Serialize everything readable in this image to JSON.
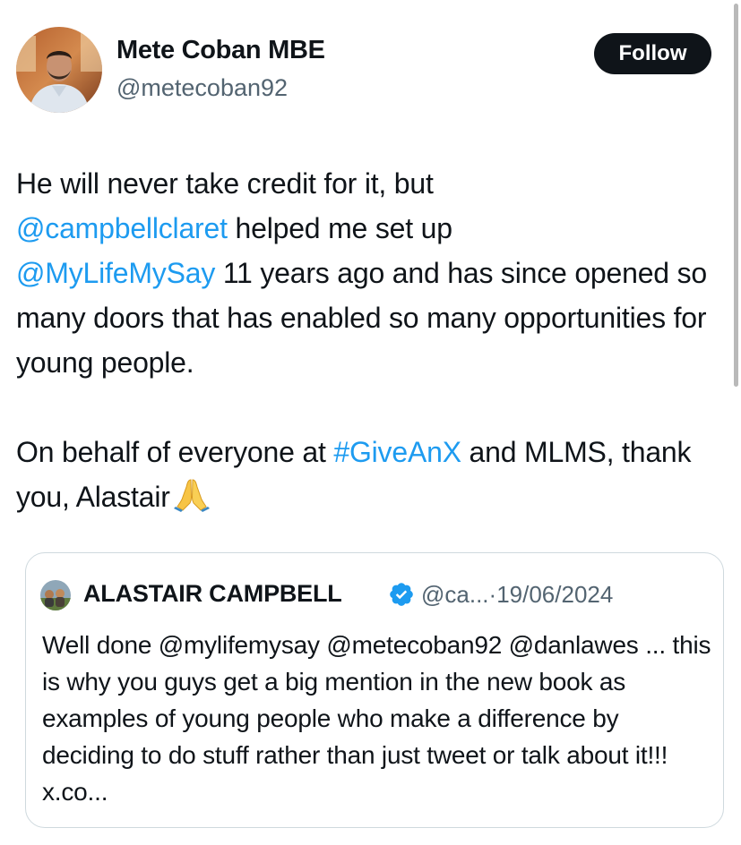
{
  "author": {
    "name": "Mete Coban MBE",
    "handle": "@metecoban92"
  },
  "follow_label": "Follow",
  "tweet": {
    "line1_text": "He will never take credit for it, but",
    "mention_campbell": "@campbellclaret",
    "line2_text": " helped me set up",
    "mention_mlms": "@MyLifeMySay",
    "line3_text": " 11 years ago and has since opened so many doors that has enabled so many opportunities for young people.",
    "para2_text": "On behalf of everyone at ",
    "hashtag": "#GiveAnX",
    "para2_after_hashtag": " and MLMS, thank you, Alastair",
    "emoji": "folded-hands-emoji"
  },
  "quote": {
    "author_name": "ALASTAIR CAMPBELL",
    "handle_truncated": "@ca...",
    "separator": "·",
    "date": "19/06/2024",
    "text": "Well done @mylifemysay @metecoban92 @danlawes ... this is why you guys get a big mention in the new book as examples of young people who make a difference by deciding to do stuff rather than just tweet or talk about it!!! x.co..."
  },
  "icons": {
    "verified": "verified-badge-icon",
    "avatar": "profile-avatar",
    "quote_avatar": "quote-profile-avatar"
  },
  "colors": {
    "link": "#1d9bf0",
    "text": "#0f1419",
    "muted": "#536471",
    "button_bg": "#0f1419",
    "border": "#cfd9de"
  }
}
